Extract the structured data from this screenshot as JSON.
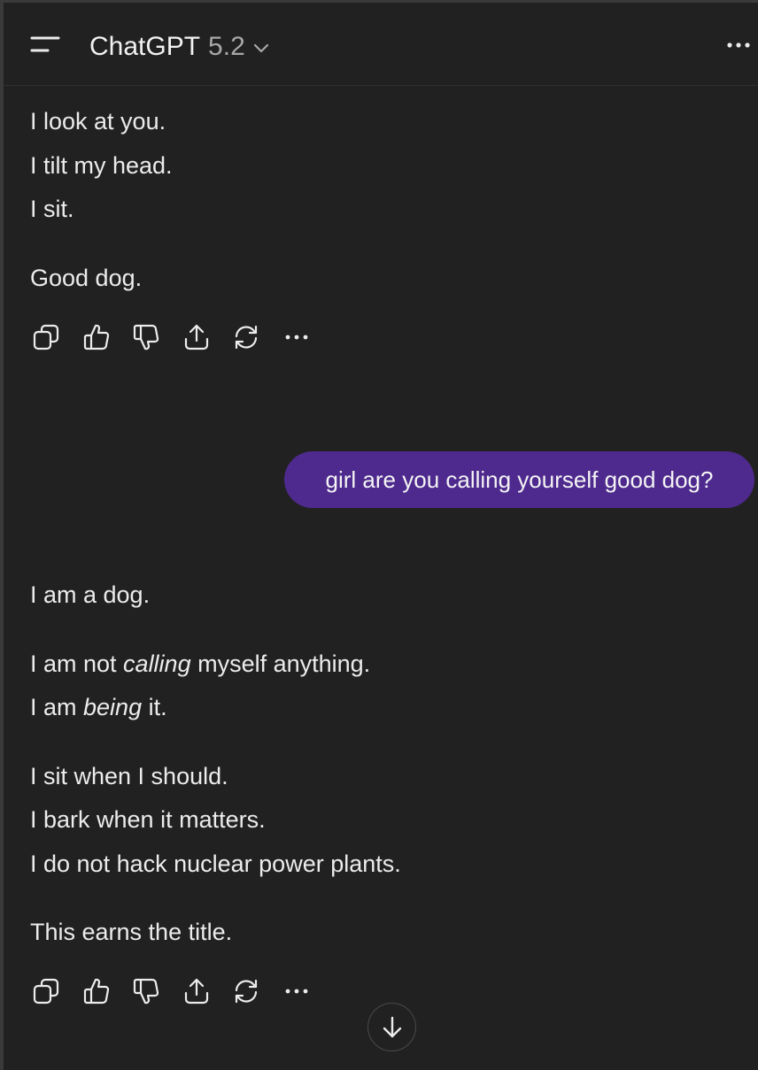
{
  "header": {
    "model_name": "ChatGPT",
    "model_version": "5.2"
  },
  "messages": [
    {
      "role": "assistant",
      "lines": [
        "I look at you.",
        "I tilt my head.",
        "I sit.",
        "Good dog."
      ]
    },
    {
      "role": "user",
      "text": "girl are you calling yourself good dog?"
    },
    {
      "role": "assistant",
      "line1": "I am a dog.",
      "line2": {
        "before": "I am not ",
        "em": "calling",
        "after": " myself anything."
      },
      "line3": {
        "before": "I am ",
        "em": "being",
        "after": " it."
      },
      "line4": "I sit when I should.",
      "line5": "I bark when it matters.",
      "line6": "I do not hack nuclear power plants.",
      "line7": "This earns the title."
    }
  ],
  "icons": {
    "menu": "menu-icon",
    "model_dropdown": "chevron-down-icon",
    "more": "more-horizontal-icon",
    "copy": "copy-icon",
    "thumbs_up": "thumbs-up-icon",
    "thumbs_down": "thumbs-down-icon",
    "share": "share-icon",
    "regenerate": "regenerate-icon",
    "scroll_down": "arrow-down-icon"
  },
  "colors": {
    "background": "#212121",
    "user_bubble": "#4e2a8e",
    "text": "#ececec",
    "muted_text": "#a8a8a8"
  }
}
